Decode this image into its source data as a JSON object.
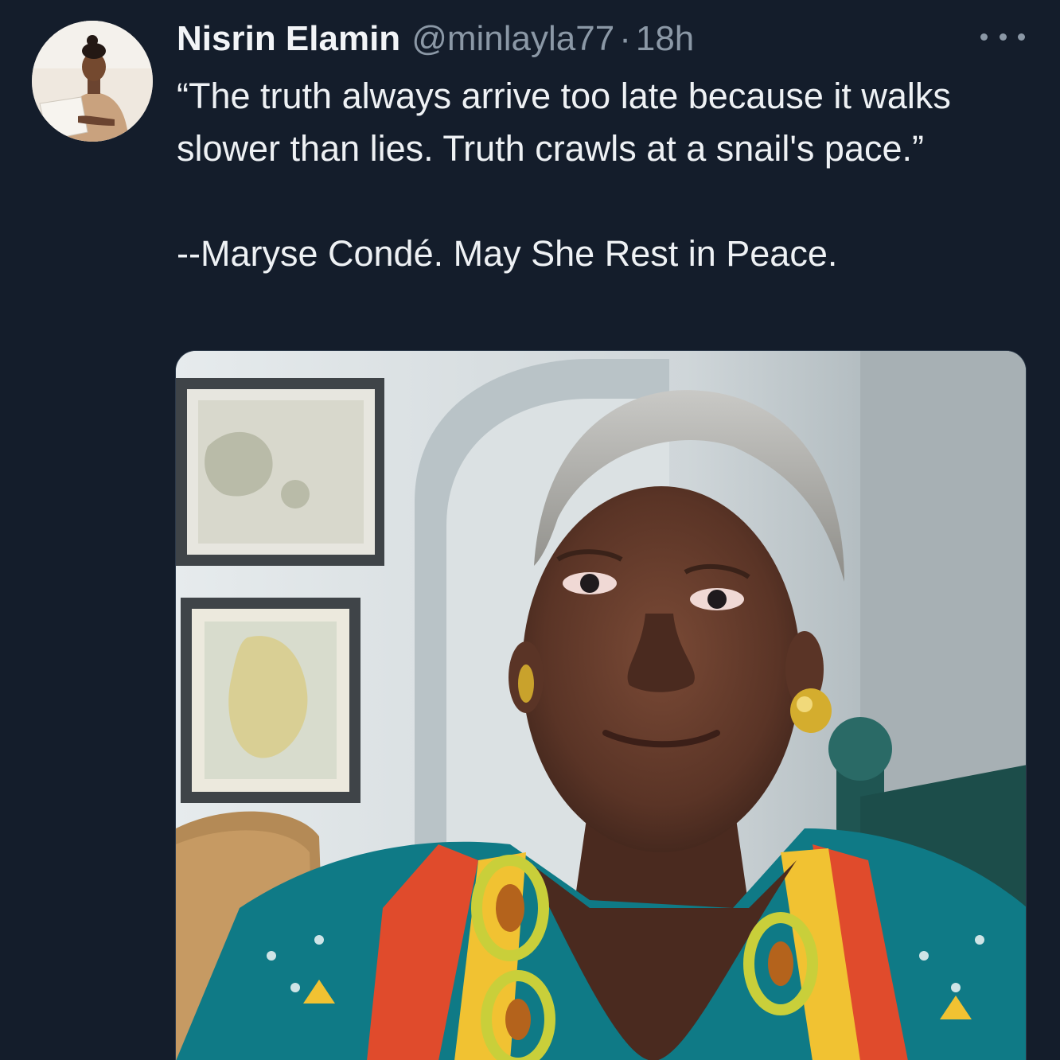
{
  "tweet": {
    "author_name": "Nisrin Elamin",
    "handle": "@minlayla77",
    "separator": "·",
    "timestamp": "18h",
    "quote_text": "“The truth always arrive too late because it walks slower than lies. Truth crawls at a snail's pace.”",
    "attribution": "--Maryse Condé. May She Rest in Peace.",
    "more_icon": "more-horizontal-icon",
    "media_description_icon": "photo"
  },
  "colors": {
    "background": "#141d2b",
    "primary_text": "#eef1f4",
    "secondary_text": "#8b98a6"
  }
}
